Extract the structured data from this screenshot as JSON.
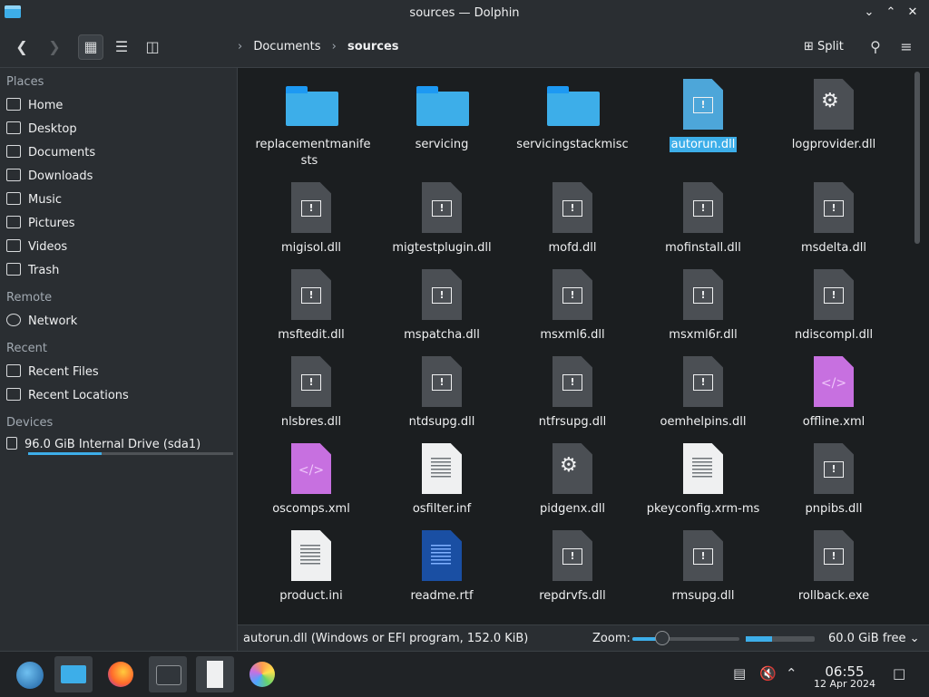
{
  "window": {
    "title": "sources — Dolphin"
  },
  "toolbar": {
    "breadcrumb": [
      "Documents",
      "sources"
    ],
    "split_label": "Split"
  },
  "sidebar": {
    "places_label": "Places",
    "places": [
      "Home",
      "Desktop",
      "Documents",
      "Downloads",
      "Music",
      "Pictures",
      "Videos",
      "Trash"
    ],
    "remote_label": "Remote",
    "remote": [
      "Network"
    ],
    "recent_label": "Recent",
    "recent": [
      "Recent Files",
      "Recent Locations"
    ],
    "devices_label": "Devices",
    "devices": [
      "96.0 GiB Internal Drive (sda1)"
    ],
    "drive_usage": 0.36
  },
  "files": [
    {
      "name": "replacementmanifests",
      "label_lines": [
        "replacementmanife",
        "sts"
      ],
      "type": "folder"
    },
    {
      "name": "servicing",
      "type": "folder"
    },
    {
      "name": "servicingstackmisc",
      "type": "folder"
    },
    {
      "name": "autorun.dll",
      "type": "dll-blue",
      "selected": true
    },
    {
      "name": "logprovider.dll",
      "type": "dll-gear"
    },
    {
      "name": "migisol.dll",
      "type": "dll"
    },
    {
      "name": "migtestplugin.dll",
      "type": "dll"
    },
    {
      "name": "mofd.dll",
      "type": "dll"
    },
    {
      "name": "mofinstall.dll",
      "type": "dll"
    },
    {
      "name": "msdelta.dll",
      "type": "dll"
    },
    {
      "name": "msftedit.dll",
      "type": "dll"
    },
    {
      "name": "mspatcha.dll",
      "type": "dll"
    },
    {
      "name": "msxml6.dll",
      "type": "dll"
    },
    {
      "name": "msxml6r.dll",
      "type": "dll"
    },
    {
      "name": "ndiscompl.dll",
      "type": "dll"
    },
    {
      "name": "nlsbres.dll",
      "type": "dll"
    },
    {
      "name": "ntdsupg.dll",
      "type": "dll"
    },
    {
      "name": "ntfrsupg.dll",
      "type": "dll"
    },
    {
      "name": "oemhelpins.dll",
      "type": "dll"
    },
    {
      "name": "offline.xml",
      "type": "xml"
    },
    {
      "name": "oscomps.xml",
      "type": "xml"
    },
    {
      "name": "osfilter.inf",
      "type": "text"
    },
    {
      "name": "pidgenx.dll",
      "type": "dll-gear"
    },
    {
      "name": "pkeyconfig.xrm-ms",
      "type": "text"
    },
    {
      "name": "pnpibs.dll",
      "type": "dll"
    },
    {
      "name": "product.ini",
      "type": "text"
    },
    {
      "name": "readme.rtf",
      "type": "rtf"
    },
    {
      "name": "repdrvfs.dll",
      "type": "dll"
    },
    {
      "name": "rmsupg.dll",
      "type": "dll"
    },
    {
      "name": "rollback.exe",
      "type": "dll"
    }
  ],
  "statusbar": {
    "selection_text": "autorun.dll (Windows or EFI program, 152.0 KiB)",
    "zoom_label": "Zoom:",
    "zoom_level": 0.28,
    "free_text": "60.0 GiB free",
    "disk_used": 0.38
  },
  "taskbar": {
    "time": "06:55",
    "date": "12 Apr 2024"
  },
  "colors": {
    "accent": "#3daee9",
    "background": "#1b1e20",
    "panel": "#2a2e32"
  }
}
